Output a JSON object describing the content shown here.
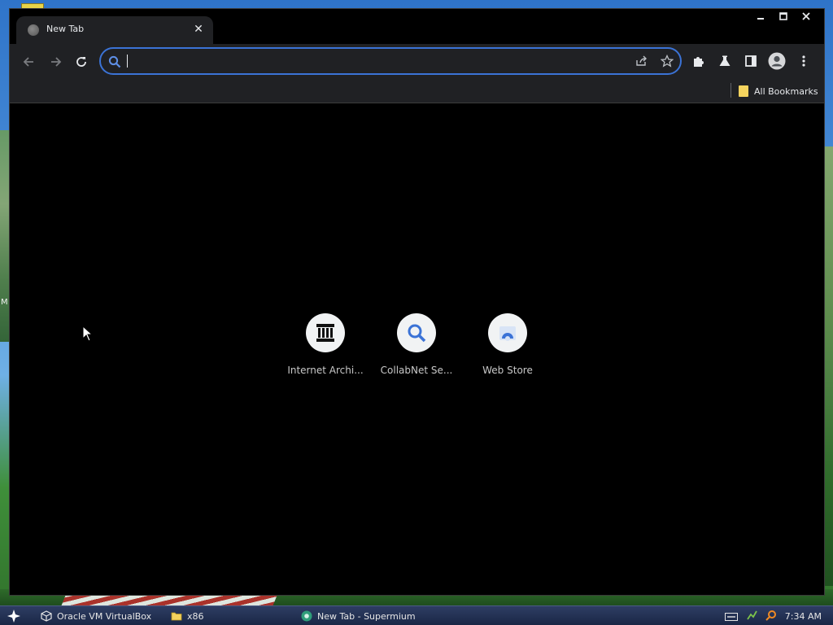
{
  "desktop": {
    "left_label": "M"
  },
  "browser": {
    "tab": {
      "title": "New Tab",
      "close_glyph": "✕",
      "favicon_icon": "globe-icon"
    },
    "window_controls": {
      "minimize_icon": "minimize-icon",
      "maximize_icon": "maximize-icon",
      "close_icon": "close-icon"
    },
    "toolbar": {
      "omnibox_value": "",
      "omnibox_placeholder": ""
    },
    "bookmarks": {
      "all_bookmarks_label": "All Bookmarks"
    },
    "shortcuts": [
      {
        "label": "Internet Archi...",
        "icon": "archive-building-icon"
      },
      {
        "label": "CollabNet Se...",
        "icon": "search-icon"
      },
      {
        "label": "Web Store",
        "icon": "web-store-icon"
      }
    ]
  },
  "taskbar": {
    "items": [
      {
        "label": "Oracle VM VirtualBox",
        "icon": "virtualbox-icon"
      },
      {
        "label": "x86",
        "icon": "folder-icon"
      },
      {
        "label": "New Tab - Supermium",
        "icon": "supermium-icon"
      }
    ],
    "clock": "7:34 AM"
  },
  "colors": {
    "window_bg": "#000000",
    "toolbar_bg": "#202124",
    "accent_blue": "#3b73d6",
    "text_light": "#e8eaed",
    "bookmark_folder": "#f4d35e",
    "taskbar_bg": "#1a2746"
  }
}
